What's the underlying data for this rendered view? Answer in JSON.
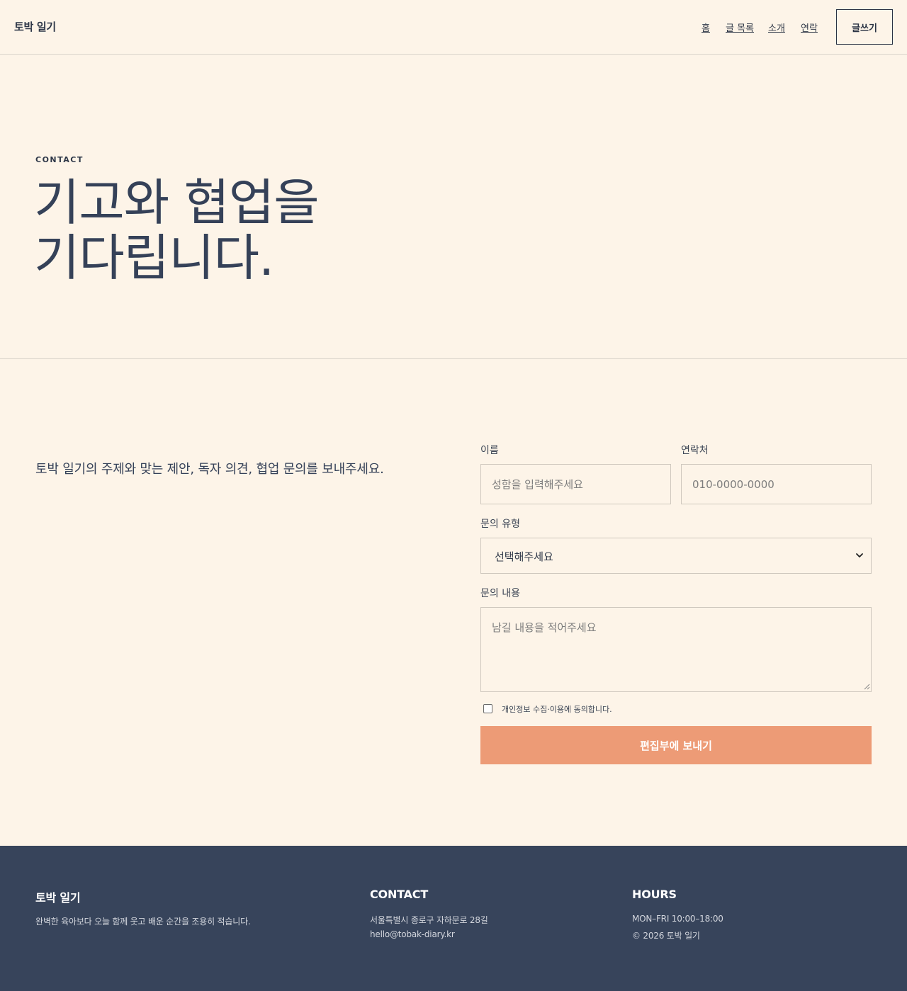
{
  "header": {
    "brand": "토박 일기",
    "nav": [
      {
        "label": "홈"
      },
      {
        "label": "글 목록"
      },
      {
        "label": "소개"
      },
      {
        "label": "연락"
      }
    ],
    "write_button": "글쓰기"
  },
  "hero": {
    "eyebrow": "CONTACT",
    "title_line1": "기고와 협업을",
    "title_line2": "기다립니다."
  },
  "contact": {
    "intro": "토박 일기의 주제와 맞는 제안, 독자 의견, 협업 문의를 보내주세요.",
    "name": {
      "label": "이름",
      "placeholder": "성함을 입력해주세요",
      "value": ""
    },
    "phone": {
      "label": "연락처",
      "placeholder": "010-0000-0000",
      "value": ""
    },
    "inquiry_type": {
      "label": "문의 유형",
      "selected": "선택해주세요"
    },
    "message": {
      "label": "문의 내용",
      "placeholder": "남길 내용을 적어주세요",
      "value": ""
    },
    "consent": {
      "label": "개인정보 수집·이용에 동의합니다.",
      "checked": false
    },
    "submit": "편집부에 보내기"
  },
  "footer": {
    "brand": "토박 일기",
    "tagline": "완벽한 육아보다 오늘 함께 웃고 배운 순간을 조용히 적습니다.",
    "contact": {
      "heading": "CONTACT",
      "address": "서울특별시 종로구 자하문로 28길",
      "email": "hello@tobak-diary.kr"
    },
    "hours": {
      "heading": "HOURS",
      "time": "MON–FRI 10:00–18:00",
      "copyright": "© 2026 토박 일기"
    }
  },
  "colors": {
    "background": "#fdf4e8",
    "text": "#354158",
    "accent": "#ed9b76",
    "footer": "#37445b"
  },
  "icons": {
    "select": "chevron-down-icon",
    "textarea": "resize-grip-icon"
  }
}
